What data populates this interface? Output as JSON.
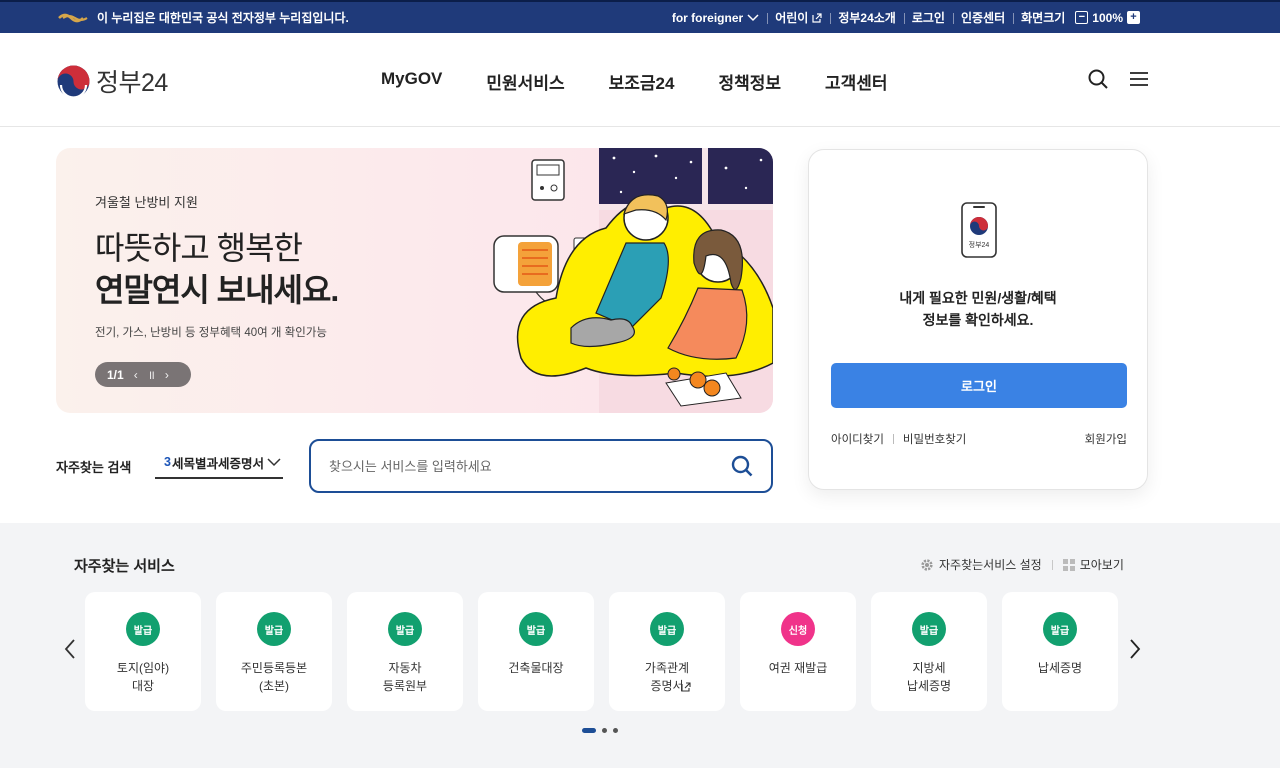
{
  "gov_bar": {
    "notice": "이 누리집은 대한민국 공식 전자정부 누리집입니다.",
    "links": [
      "for foreigner",
      "어린이",
      "정부24소개",
      "로그인",
      "인증센터",
      "화면크기"
    ],
    "zoom": "100%"
  },
  "header": {
    "brand": "정부24",
    "nav": [
      "MyGOV",
      "민원서비스",
      "보조금24",
      "정책정보",
      "고객센터"
    ]
  },
  "banner": {
    "subtitle": "겨울철 난방비 지원",
    "headline_1": "따뜻하고 행복한",
    "headline_2": "연말연시 보내세요.",
    "description": "전기, 가스, 난방비 등 정부혜택 40여 개 확인가능",
    "pager": "1/1"
  },
  "search": {
    "label": "자주찾는 검색",
    "select_number": "3",
    "select_text": "세목별과세증명서",
    "placeholder": "찾으시는 서비스를 입력하세요"
  },
  "login": {
    "app_label": "정부24",
    "message_1": "내게 필요한 민원/생활/혜택",
    "message_2": "정보를 확인하세요.",
    "button": "로그인",
    "find_id": "아이디찾기",
    "find_pw": "비밀번호찾기",
    "join": "회원가입"
  },
  "frequent": {
    "title": "자주찾는 서비스",
    "settings": "자주찾는서비스 설정",
    "view_all": "모아보기",
    "services": [
      {
        "badge": "발급",
        "label": "토지(임야)\n대장",
        "color": "#12a06f"
      },
      {
        "badge": "발급",
        "label": "주민등록등본\n(초본)",
        "color": "#12a06f"
      },
      {
        "badge": "발급",
        "label": "자동차\n등록원부",
        "color": "#12a06f"
      },
      {
        "badge": "발급",
        "label": "건축물대장",
        "color": "#12a06f"
      },
      {
        "badge": "발급",
        "label": "가족관계\n증명서",
        "color": "#12a06f",
        "external": true
      },
      {
        "badge": "신청",
        "label": "여권 재발급",
        "color": "#f0338a"
      },
      {
        "badge": "발급",
        "label": "지방세\n납세증명",
        "color": "#12a06f"
      },
      {
        "badge": "발급",
        "label": "납세증명",
        "color": "#12a06f"
      }
    ]
  },
  "colors": {
    "gov_bar": "#1f3a7a",
    "primary_button": "#3a82e4",
    "search_border": "#1d4e96",
    "badge_green": "#12a06f",
    "badge_pink": "#f0338a"
  }
}
